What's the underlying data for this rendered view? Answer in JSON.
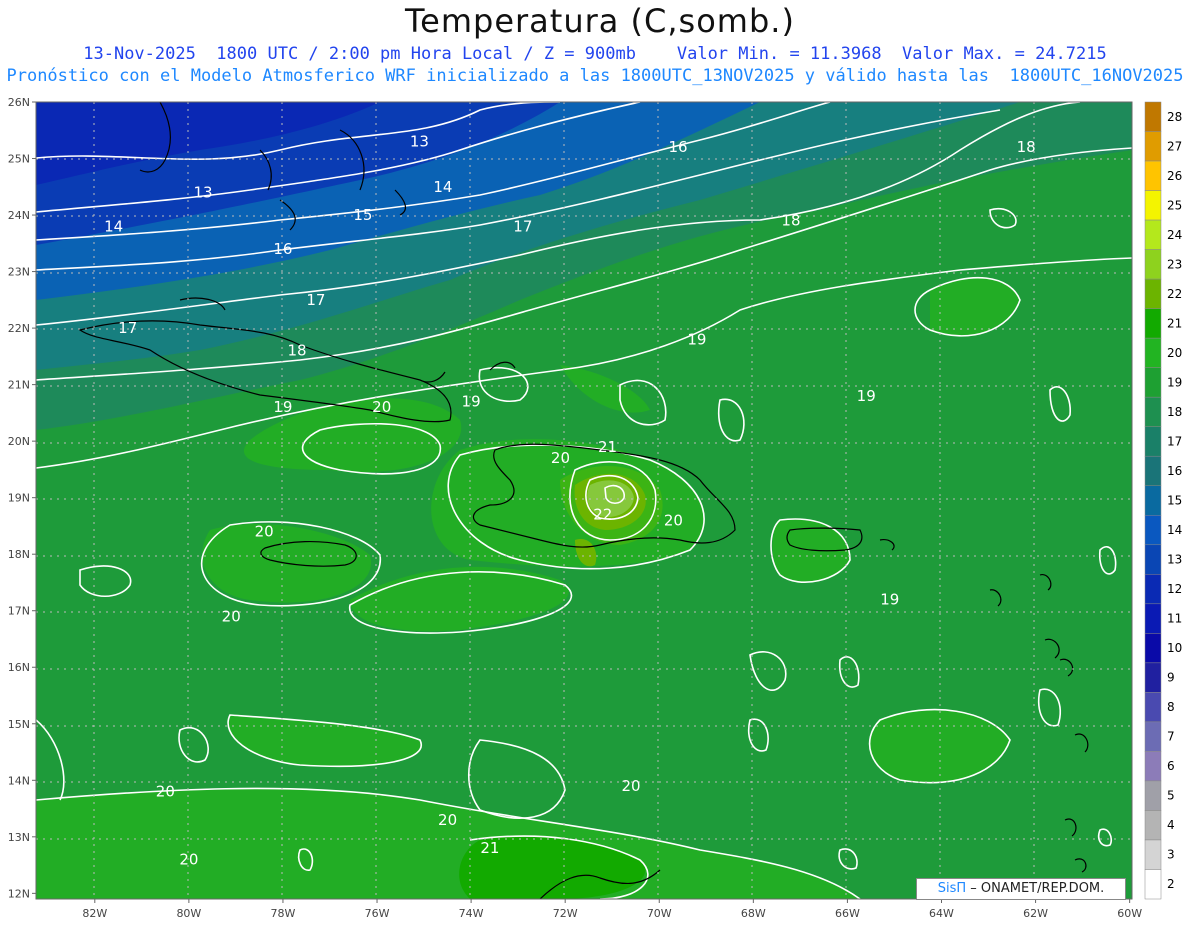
{
  "title": "Temperatura (C,somb.)",
  "subtitle_line1": "13-Nov-2025  1800 UTC / 2:00 pm Hora Local / Z = 900mb    Valor Min. = 11.3968  Valor Max. = 24.7215",
  "subtitle_line2": "Pronóstico con el Modelo Atmosferico WRF inicializado a las 1800UTC_13NOV2025 y válido hasta las  1800UTC_16NOV2025",
  "credit": {
    "brand": "SisΠ",
    "text": " – ONAMET/REP.DOM."
  },
  "map": {
    "lat_labels": [
      "26N",
      "25N",
      "24N",
      "23N",
      "22N",
      "21N",
      "20N",
      "19N",
      "18N",
      "17N",
      "16N",
      "15N",
      "14N",
      "13N",
      "12N"
    ],
    "lon_labels": [
      "82W",
      "80W",
      "78W",
      "76W",
      "74W",
      "72W",
      "70W",
      "68W",
      "66W",
      "64W",
      "62W",
      "60W"
    ],
    "contour_labels": [
      {
        "text": "13",
        "lon": -75.1,
        "lat": 25.3
      },
      {
        "text": "13",
        "lon": -79.7,
        "lat": 24.4
      },
      {
        "text": "14",
        "lon": -74.6,
        "lat": 24.5
      },
      {
        "text": "14",
        "lon": -81.6,
        "lat": 23.8
      },
      {
        "text": "15",
        "lon": -76.3,
        "lat": 24.0
      },
      {
        "text": "16",
        "lon": -69.6,
        "lat": 25.2
      },
      {
        "text": "16",
        "lon": -78.0,
        "lat": 23.4
      },
      {
        "text": "17",
        "lon": -72.9,
        "lat": 23.8
      },
      {
        "text": "17",
        "lon": -77.3,
        "lat": 22.5
      },
      {
        "text": "17",
        "lon": -81.3,
        "lat": 22.0
      },
      {
        "text": "18",
        "lon": -67.2,
        "lat": 23.9
      },
      {
        "text": "18",
        "lon": -62.2,
        "lat": 25.2
      },
      {
        "text": "18",
        "lon": -77.7,
        "lat": 21.6
      },
      {
        "text": "19",
        "lon": -69.2,
        "lat": 21.8
      },
      {
        "text": "19",
        "lon": -74.0,
        "lat": 20.7
      },
      {
        "text": "19",
        "lon": -78.0,
        "lat": 20.6
      },
      {
        "text": "19",
        "lon": -65.6,
        "lat": 20.8
      },
      {
        "text": "19",
        "lon": -65.1,
        "lat": 17.2
      },
      {
        "text": "20",
        "lon": -75.9,
        "lat": 20.6
      },
      {
        "text": "20",
        "lon": -72.1,
        "lat": 19.7
      },
      {
        "text": "20",
        "lon": -69.7,
        "lat": 18.6
      },
      {
        "text": "20",
        "lon": -78.4,
        "lat": 18.4
      },
      {
        "text": "20",
        "lon": -79.1,
        "lat": 16.9
      },
      {
        "text": "20",
        "lon": -80.5,
        "lat": 13.8
      },
      {
        "text": "20",
        "lon": -74.5,
        "lat": 13.3
      },
      {
        "text": "20",
        "lon": -70.6,
        "lat": 13.9
      },
      {
        "text": "20",
        "lon": -80.0,
        "lat": 12.6
      },
      {
        "text": "21",
        "lon": -71.1,
        "lat": 19.9
      },
      {
        "text": "21",
        "lon": -73.6,
        "lat": 12.8
      },
      {
        "text": "22",
        "lon": -71.2,
        "lat": 18.7
      }
    ]
  },
  "colorbar": {
    "labels": [
      "28",
      "27",
      "26",
      "25",
      "24",
      "23",
      "22",
      "21",
      "20",
      "19",
      "18",
      "17",
      "16",
      "15",
      "14",
      "13",
      "12",
      "11",
      "10",
      "9",
      "8",
      "7",
      "6",
      "5",
      "4",
      "3",
      "2"
    ],
    "colors": [
      "#c07800",
      "#e09c00",
      "#ffc400",
      "#f4f400",
      "#b4e81c",
      "#8ed21e",
      "#6cb400",
      "#12aa00",
      "#22b422",
      "#1ea032",
      "#1e9050",
      "#1a8068",
      "#1a7478",
      "#0a6aa0",
      "#0a58c0",
      "#0a46b4",
      "#0a2ab4",
      "#0a1ab4",
      "#0a0aa8",
      "#2020a0",
      "#4a4ab0",
      "#6c6cb4",
      "#8c7cb8",
      "#a0a0a8",
      "#b4b4b4",
      "#d4d4d4",
      "#ffffff"
    ]
  },
  "colors": {
    "ocean_dark_blue": "#0a28b4",
    "band_blue": "#0a62b4",
    "band_teal": "#177f7f",
    "band_teal_green": "#1e8a5a",
    "sea_green": "#1e9b3a",
    "land_green": "#22ad25",
    "hot_yellow_green": "#86c83c",
    "contour": "#ffffff",
    "coast": "#000000"
  }
}
